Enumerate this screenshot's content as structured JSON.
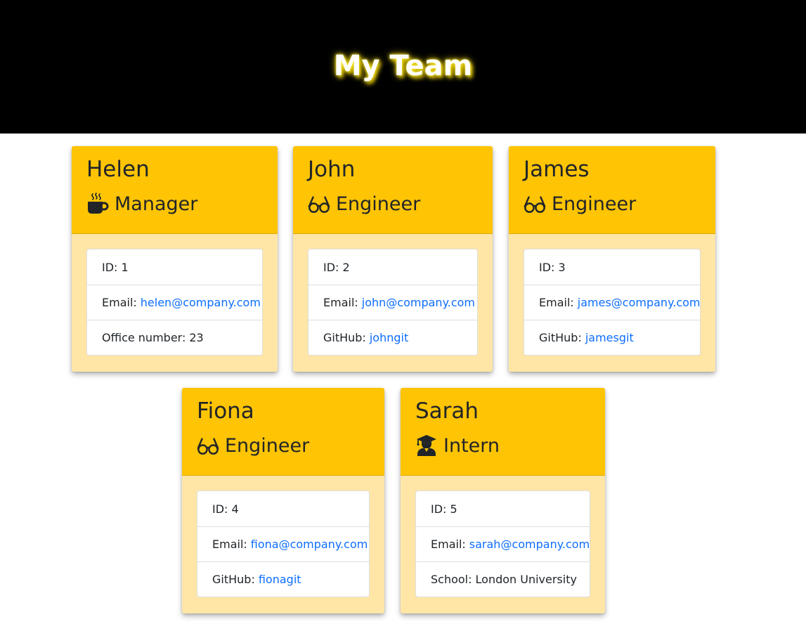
{
  "header": {
    "title": "My Team"
  },
  "colors": {
    "header_bg": "#000000",
    "card_head": "#ffc404",
    "card_body": "#ffe6a7",
    "link": "#0d6efd"
  },
  "employees": [
    {
      "name": "Helen",
      "role": "Manager",
      "role_icon": "mug-hot-icon",
      "id_label": "ID: 1",
      "email_label": "Email:",
      "email": "helen@company.com",
      "extra_label": "Office number:",
      "extra_value": "23"
    },
    {
      "name": "John",
      "role": "Engineer",
      "role_icon": "glasses-icon",
      "id_label": "ID: 2",
      "email_label": "Email:",
      "email": "john@company.com",
      "extra_label": "GitHub:",
      "extra_value": "johngit"
    },
    {
      "name": "James",
      "role": "Engineer",
      "role_icon": "glasses-icon",
      "id_label": "ID: 3",
      "email_label": "Email:",
      "email": "james@company.com",
      "extra_label": "GitHub:",
      "extra_value": "jamesgit"
    },
    {
      "name": "Fiona",
      "role": "Engineer",
      "role_icon": "glasses-icon",
      "id_label": "ID: 4",
      "email_label": "Email:",
      "email": "fiona@company.com",
      "extra_label": "GitHub:",
      "extra_value": "fionagit"
    },
    {
      "name": "Sarah",
      "role": "Intern",
      "role_icon": "graduate-icon",
      "id_label": "ID: 5",
      "email_label": "Email:",
      "email": "sarah@company.com",
      "extra_label": "School:",
      "extra_value": "London University"
    }
  ]
}
